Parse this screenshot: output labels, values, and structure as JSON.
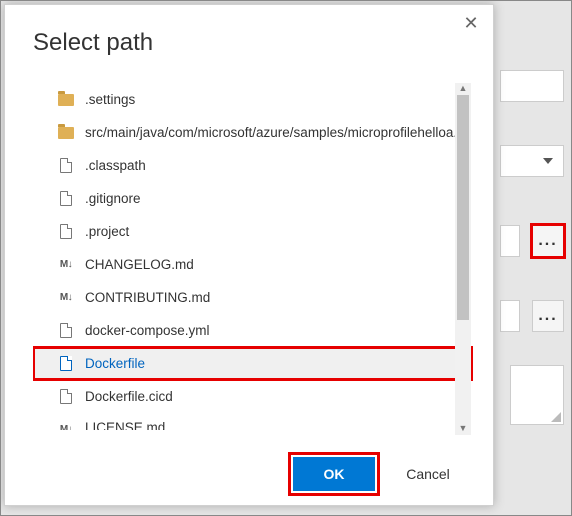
{
  "dialog": {
    "title": "Select path",
    "ok_label": "OK",
    "cancel_label": "Cancel"
  },
  "files": [
    {
      "name": ".settings",
      "type": "folder"
    },
    {
      "name": "src/main/java/com/microsoft/azure/samples/microprofilehelloa...",
      "type": "folder"
    },
    {
      "name": ".classpath",
      "type": "file"
    },
    {
      "name": ".gitignore",
      "type": "file"
    },
    {
      "name": ".project",
      "type": "file"
    },
    {
      "name": "CHANGELOG.md",
      "type": "md"
    },
    {
      "name": "CONTRIBUTING.md",
      "type": "md"
    },
    {
      "name": "docker-compose.yml",
      "type": "file"
    },
    {
      "name": "Dockerfile",
      "type": "file",
      "selected": true
    },
    {
      "name": "Dockerfile.cicd",
      "type": "file"
    },
    {
      "name": "LICENSE.md",
      "type": "md"
    }
  ],
  "bg": {
    "ellipsis": "..."
  }
}
